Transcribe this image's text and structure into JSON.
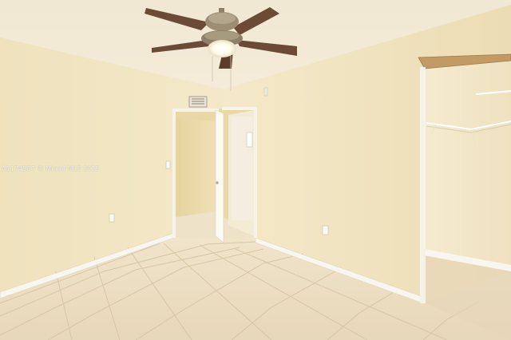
{
  "scene": {
    "subject": "empty-bedroom",
    "wall_color": "#efe3c1",
    "ceiling_color": "#f1ead6",
    "floor_tile_color": "#ecdcc0",
    "baseboard_color": "#f8f6ef",
    "fan_blade_color": "#6b4a36"
  },
  "watermark": {
    "text": "A1174587 © Miami MLS 2025"
  }
}
